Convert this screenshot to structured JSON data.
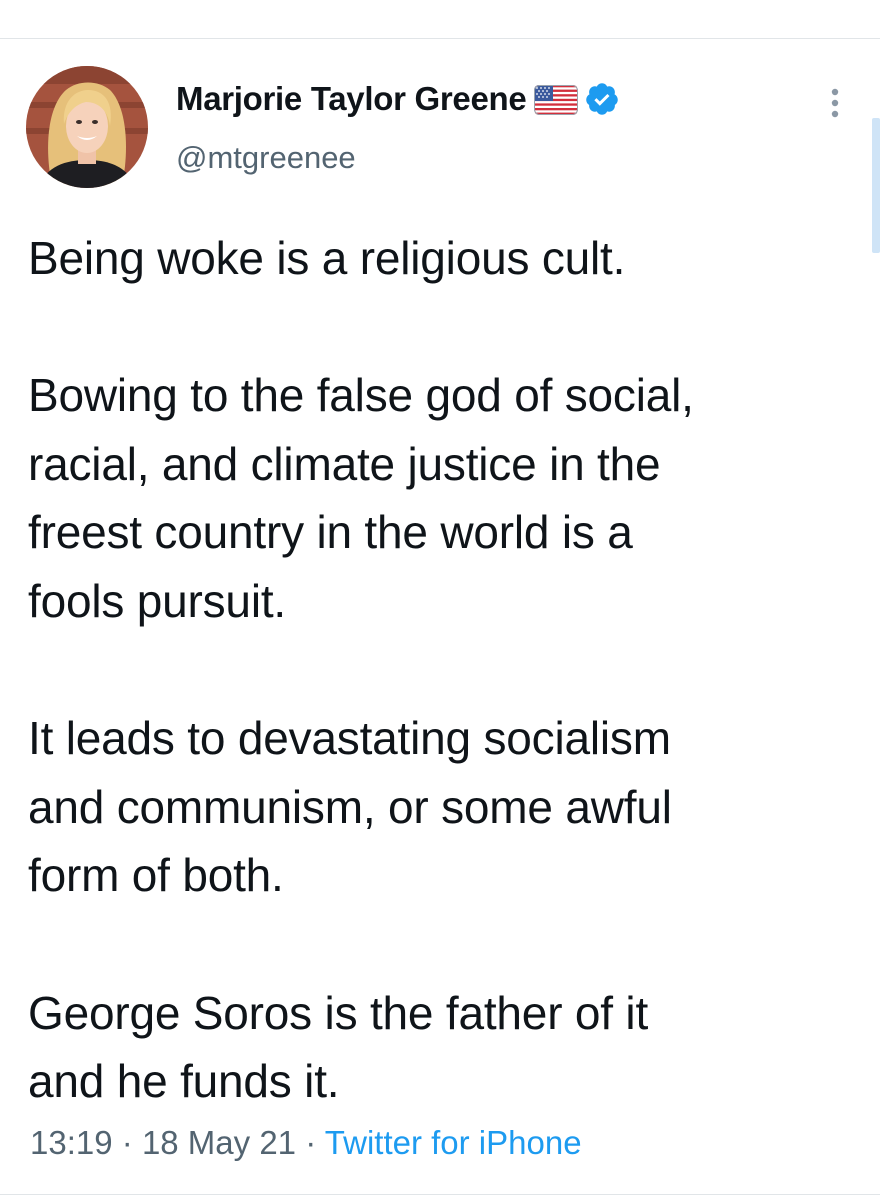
{
  "tweet": {
    "author": {
      "name": "Marjorie Taylor Greene",
      "handle": "@mtgreenee",
      "flag_icon": "us-flag-icon",
      "verified_icon": "verified-badge-icon",
      "verified_color": "#1d9bf0"
    },
    "more_icon": "more-vertical-icon",
    "paragraphs": [
      [
        "Being woke is a religious cult."
      ],
      [
        "Bowing to the false god of social,",
        "racial, and climate justice in the",
        "freest country in the world is a",
        "fools pursuit."
      ],
      [
        "It leads to devastating socialism",
        "and communism, or some awful",
        "form of both."
      ],
      [
        "George Soros is the father of it",
        "and he funds it."
      ]
    ],
    "time": "13:19",
    "date": "18 May 21",
    "separator": "·",
    "source": "Twitter for iPhone",
    "link_color": "#1d9bf0"
  }
}
